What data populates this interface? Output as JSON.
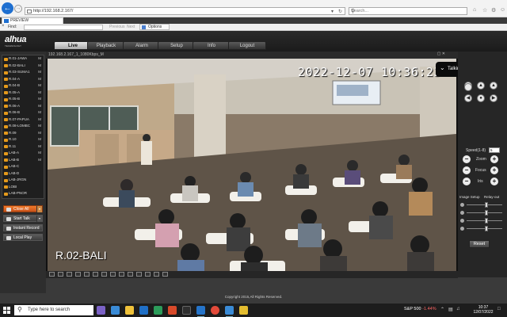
{
  "browser": {
    "url": "http://192.168.2.167/",
    "search_placeholder": "Search...",
    "tab_title": "PREVIEW",
    "find_label": "Find:",
    "find_prev": "Previous",
    "find_next": "Next",
    "find_options": "Options"
  },
  "app": {
    "logo": "alhua",
    "logo_sub": "TECHNOLOGY",
    "tabs": [
      {
        "label": "Live",
        "active": true
      },
      {
        "label": "Playback"
      },
      {
        "label": "Alarm"
      },
      {
        "label": "Setup"
      },
      {
        "label": "Info"
      },
      {
        "label": "Logout"
      }
    ]
  },
  "cameras": [
    {
      "label": "R.01-JAWA",
      "mark": "M"
    },
    {
      "label": "R.02-BALI",
      "mark": "M"
    },
    {
      "label": "R.03-SUMA1",
      "mark": "M"
    },
    {
      "label": "R.04-A",
      "mark": "M"
    },
    {
      "label": "R.04-B",
      "mark": "M"
    },
    {
      "label": "R.05-A",
      "mark": "M"
    },
    {
      "label": "R.05-B",
      "mark": "M"
    },
    {
      "label": "R.06-A",
      "mark": "M"
    },
    {
      "label": "R.06-B",
      "mark": "M"
    },
    {
      "label": "R.07-PAPUA",
      "mark": "M"
    },
    {
      "label": "R.08-LOMBC",
      "mark": "M"
    },
    {
      "label": "R.09",
      "mark": "M"
    },
    {
      "label": "R.10",
      "mark": "M"
    },
    {
      "label": "R.11",
      "mark": "M"
    },
    {
      "label": "LAB-A",
      "mark": "M"
    },
    {
      "label": "LAB-B",
      "mark": "M"
    },
    {
      "label": "LAB-C",
      "mark": ""
    },
    {
      "label": "LAB-D",
      "mark": ""
    },
    {
      "label": "LAB-JRGN",
      "mark": ""
    },
    {
      "label": "LOBI",
      "mark": ""
    },
    {
      "label": "LAB-PNOR",
      "mark": ""
    }
  ],
  "controls": {
    "close_all": "Close All",
    "start_talk": "Start Talk",
    "instant_record": "Instant Record",
    "local_play": "Local Play"
  },
  "video": {
    "stream_info": "192.168.2.167_1_1080Kbps_M",
    "timestamp": "2022-12-07 10:36:23",
    "channel_name": "R.02-BALI"
  },
  "talk_popup": "Talking",
  "ptz": {
    "speed_label": "Speed(1-8)",
    "speed_value": "5",
    "zoom_label": "Zoom",
    "focus_label": "Focus",
    "iris_label": "Iris",
    "image_setup": "Image Setup",
    "relay_out": "Relay-out",
    "reset": "Reset",
    "sliders": [
      0.55,
      0.55,
      0.55,
      0.55
    ]
  },
  "footer": "Copyright 2015,All Rights Reserved.",
  "taskbar": {
    "search": "Type here to search",
    "stock_name": "S&P 500",
    "stock_change": "-1.44%",
    "time": "10:37",
    "date": "12/07/2022"
  }
}
